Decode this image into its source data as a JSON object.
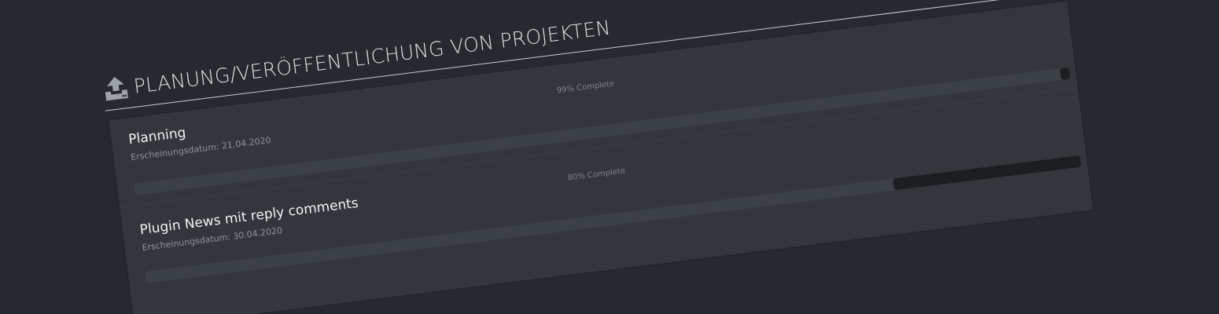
{
  "section": {
    "title": "PLANUNG/VERÖFFENTLICHUNG VON PROJEKTEN",
    "icon": "upload-icon"
  },
  "projects": [
    {
      "title": "Planning",
      "date": "Erscheinungsdatum: 21.04.2020",
      "progress_label": "99% Complete",
      "progress": 99
    },
    {
      "title": "Plugin News mit reply comments",
      "date": "Erscheinungsdatum: 30.04.2020",
      "progress_label": "80% Complete",
      "progress": 80
    }
  ],
  "colors": {
    "background": "#26292d",
    "panel": "#33373c",
    "track": "#3c4146",
    "fill": "#1c1e21",
    "title_text": "#dfe1e4"
  }
}
